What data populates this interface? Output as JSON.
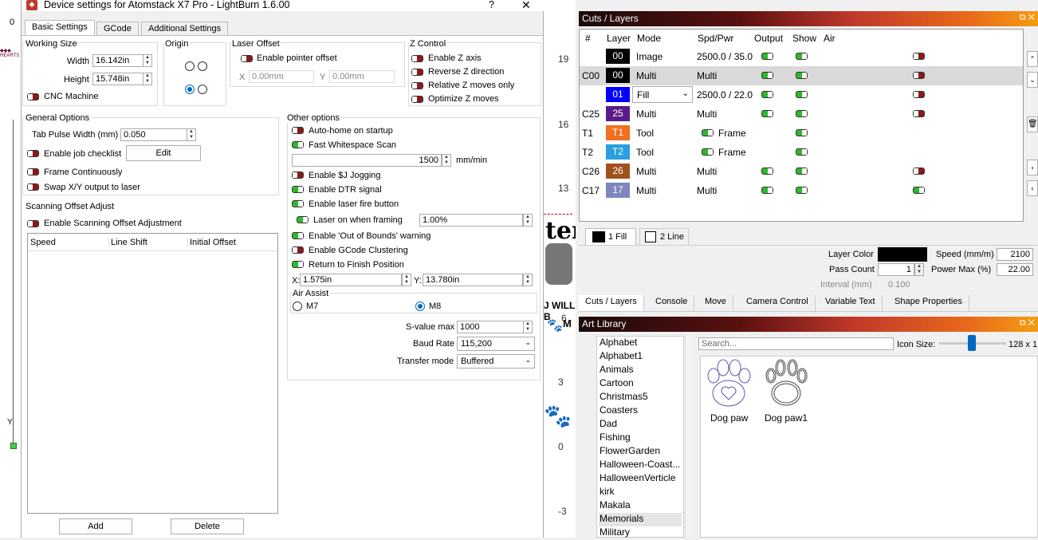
{
  "dialog": {
    "title": "Device settings for Atomstack X7 Pro - LightBurn 1.6.00",
    "help": "?",
    "close": "✕",
    "tabs": [
      "Basic Settings",
      "GCode",
      "Additional Settings"
    ],
    "working_size": {
      "title": "Working Size",
      "width_label": "Width",
      "width": "16.142in",
      "height_label": "Height",
      "height": "15.748in",
      "cnc_label": "CNC Machine",
      "cnc_on": false
    },
    "origin": {
      "title": "Origin"
    },
    "laser_offset": {
      "title": "Laser Offset",
      "enable_label": "Enable pointer offset",
      "x_label": "X",
      "x": "0.00mm",
      "y_label": "Y",
      "y": "0.00mm"
    },
    "z_control": {
      "title": "Z Control",
      "items": [
        "Enable Z axis",
        "Reverse Z direction",
        "Relative Z moves only",
        "Optimize Z moves"
      ]
    },
    "general": {
      "title": "General Options",
      "tab_pulse_label": "Tab Pulse Width (mm)",
      "tab_pulse": "0.050",
      "job_checklist": "Enable job checklist",
      "edit_btn": "Edit",
      "frame_cont": "Frame Continuously",
      "swap_xy": "Swap X/Y output to laser"
    },
    "scan_offset": {
      "title": "Scanning Offset Adjust",
      "enable_label": "Enable Scanning Offset Adjustment",
      "columns": [
        "Speed",
        "Line Shift",
        "Initial Offset"
      ],
      "add_btn": "Add",
      "delete_btn": "Delete"
    },
    "other": {
      "title": "Other options",
      "auto_home": "Auto-home on startup",
      "fast_ws": "Fast Whitespace Scan",
      "ws_speed": "1500",
      "ws_unit": "mm/min",
      "sj_jog": "Enable $J Jogging",
      "dtr": "Enable DTR signal",
      "fire_btn": "Enable laser fire button",
      "laser_framing": "Laser on when framing",
      "laser_framing_val": "1.00%",
      "oob": "Enable 'Out of Bounds' warning",
      "gcode_cluster": "Enable GCode Clustering",
      "return_finish": "Return to Finish Position",
      "x_label": "X:",
      "x": "1.575in",
      "y_label": "Y:",
      "y": "13.780in",
      "air_title": "Air Assist",
      "m7": "M7",
      "m8": "M8",
      "svalue_label": "S-value max",
      "svalue": "1000",
      "baud_label": "Baud Rate",
      "baud": "115,200",
      "transfer_label": "Transfer mode",
      "transfer": "Buffered"
    }
  },
  "ruler": {
    "labels": [
      "19",
      "16",
      "13",
      "6",
      "3",
      "0",
      "-3"
    ],
    "left_zero": "0",
    "y_axis": "Y"
  },
  "canvas_text": {
    "ter": "ter",
    "will": "J WILL B",
    "mi": "M"
  },
  "cuts": {
    "title": "Cuts / Layers",
    "columns": [
      "#",
      "Layer",
      "Mode",
      "Spd/Pwr",
      "Output",
      "Show",
      "Air"
    ],
    "rows": [
      {
        "num": "",
        "layer": "00",
        "color": "#000000",
        "mode": "Image",
        "spd": "2500.0 / 35.0",
        "output": true,
        "show": true,
        "air": false
      },
      {
        "num": "C00",
        "layer": "00",
        "color": "#000000",
        "mode": "Multi",
        "spd": "Multi",
        "output": true,
        "show": true,
        "air": false
      },
      {
        "num": "",
        "layer": "01",
        "color": "#0000ff",
        "mode": "Fill",
        "spd": "2500.0 / 22.0",
        "output": true,
        "show": true,
        "air": false
      },
      {
        "num": "C25",
        "layer": "25",
        "color": "#5b1a8a",
        "mode": "Multi",
        "spd": "Multi",
        "output": true,
        "show": true,
        "air": false
      },
      {
        "num": "T1",
        "layer": "T1",
        "color": "#f07020",
        "mode": "Tool",
        "spd": "Frame",
        "output": null,
        "show": true,
        "air": null
      },
      {
        "num": "T2",
        "layer": "T2",
        "color": "#2aa0e0",
        "mode": "Tool",
        "spd": "Frame",
        "output": null,
        "show": true,
        "air": null
      },
      {
        "num": "C26",
        "layer": "26",
        "color": "#a0521c",
        "mode": "Multi",
        "spd": "Multi",
        "output": true,
        "show": true,
        "air": false
      },
      {
        "num": "C17",
        "layer": "17",
        "color": "#7f86bf",
        "mode": "Multi",
        "spd": "Multi",
        "output": true,
        "show": true,
        "air": true
      }
    ],
    "subtabs": [
      "1 Fill",
      "2 Line"
    ],
    "layer_color_label": "Layer Color",
    "speed_label": "Speed (mm/m)",
    "speed": "2100",
    "pass_label": "Pass Count",
    "pass": "1",
    "power_label": "Power Max (%)",
    "power": "22.00",
    "interval_label": "Interval (mm)",
    "interval": "0.100"
  },
  "bottom_tabs": [
    "Cuts / Layers",
    "Console",
    "Move",
    "Camera Control",
    "Variable Text",
    "Shape Properties"
  ],
  "art": {
    "title": "Art Library",
    "search_placeholder": "Search...",
    "icon_size_label": "Icon Size:",
    "icon_size": "128 x 1",
    "categories": [
      "Alphabet",
      "Alphabet1",
      "Animals",
      "Cartoon",
      "Christmas5",
      "Coasters",
      "Dad",
      "Fishing",
      "FlowerGarden",
      "Halloween-Coast...",
      "HalloweenVerticle",
      "kirk",
      "Makala",
      "Memorials",
      "Military"
    ],
    "selected": "Memorials",
    "items": [
      "Dog paw",
      "Dog paw1"
    ]
  }
}
